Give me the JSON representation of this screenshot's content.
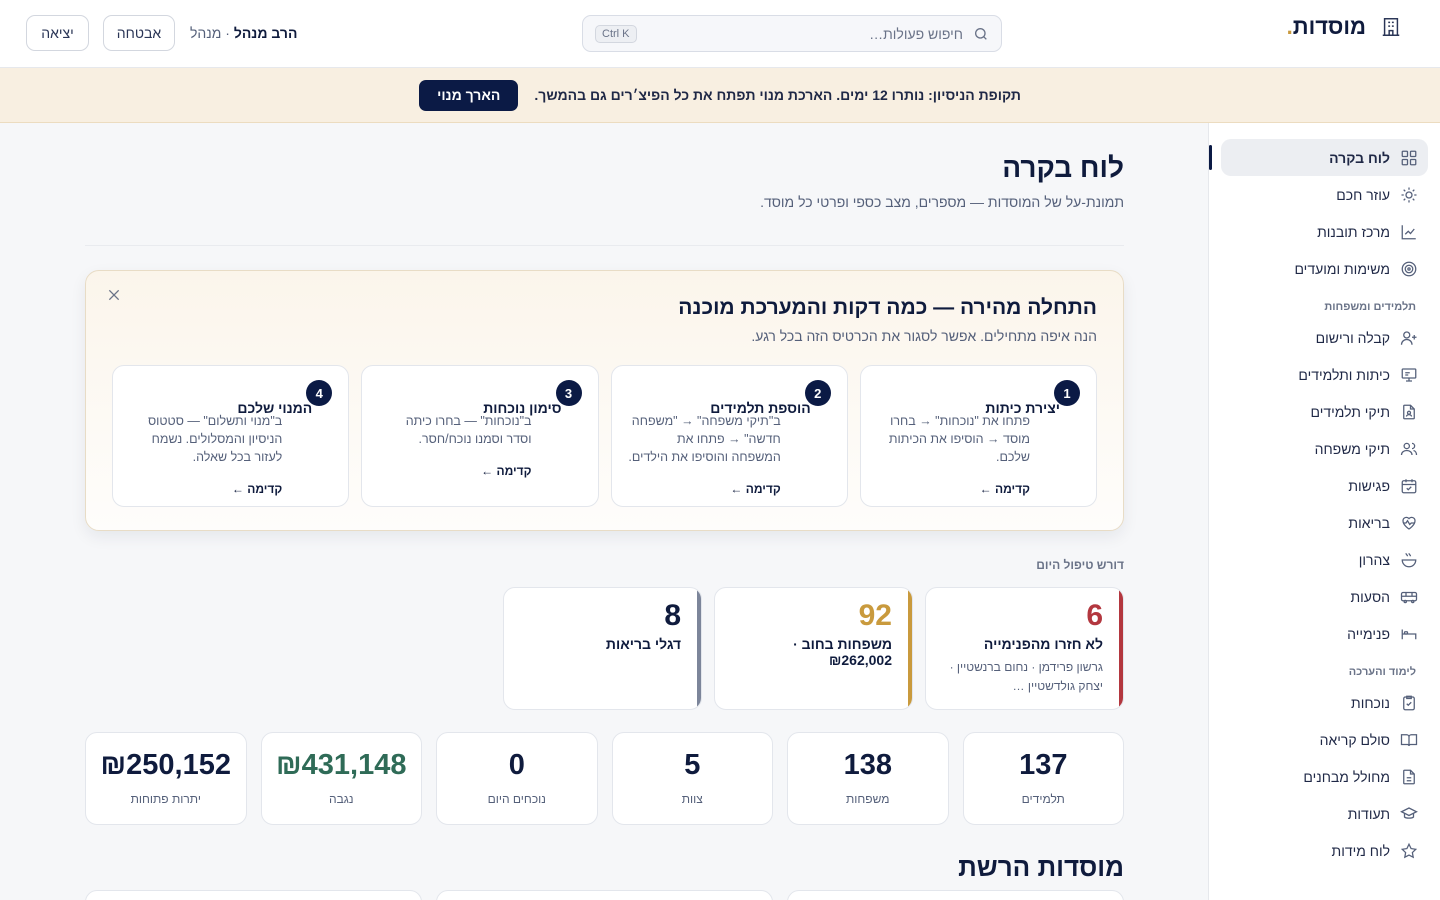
{
  "app": {
    "brand_name": "מוסדות",
    "brand_dot": "."
  },
  "header": {
    "search_placeholder": "חיפוש פעולות…",
    "search_shortcut": "Ctrl K",
    "user_name": "הרב מנהל",
    "user_role": " · מנהל",
    "security_label": "אבטחה",
    "logout_label": "יציאה"
  },
  "banner": {
    "text": "תקופת הניסיון: נותרו 12 ימים. הארכת מנוי תפתח את כל הפיצ׳רים גם בהמשך.",
    "button": "הארך מנוי"
  },
  "sidebar": {
    "top_items": [
      {
        "label": "לוח בקרה",
        "icon": "grid-icon",
        "active": true
      },
      {
        "label": "עוזר חכם",
        "icon": "sun-icon"
      },
      {
        "label": "מרכז תובנות",
        "icon": "chart-line-icon"
      },
      {
        "label": "משימות ומועדים",
        "icon": "target-icon"
      }
    ],
    "section_students": "תלמידים ומשפחות",
    "student_items": [
      {
        "label": "קבלה ורישום",
        "icon": "user-plus-icon"
      },
      {
        "label": "כיתות ותלמידים",
        "icon": "presentation-icon"
      },
      {
        "label": "תיקי תלמידים",
        "icon": "file-user-icon"
      },
      {
        "label": "תיקי משפחה",
        "icon": "users-icon"
      },
      {
        "label": "פגישות",
        "icon": "calendar-check-icon"
      },
      {
        "label": "בריאות",
        "icon": "heart-pulse-icon"
      },
      {
        "label": "צהרון",
        "icon": "bowl-icon"
      },
      {
        "label": "הסעות",
        "icon": "bus-icon"
      },
      {
        "label": "פנימייה",
        "icon": "bed-icon"
      }
    ],
    "section_learning": "לימוד והערכה",
    "learning_items": [
      {
        "label": "נוכחות",
        "icon": "clipboard-check-icon"
      },
      {
        "label": "סולם קריאה",
        "icon": "book-open-icon"
      },
      {
        "label": "מחולל מבחנים",
        "icon": "file-text-icon"
      },
      {
        "label": "תעודות",
        "icon": "graduation-cap-icon"
      },
      {
        "label": "לוח מידות",
        "icon": "star-icon"
      }
    ]
  },
  "main": {
    "title": "לוח בקרה",
    "subtitle": "תמונת-על של המוסדות — מספרים, מצב כספי ופרטי כל מוסד.",
    "onboarding": {
      "title": "התחלה מהירה — כמה דקות והמערכת מוכנה",
      "subtitle": "הנה איפה מתחילים. אפשר לסגור את הכרטיס הזה בכל רגע.",
      "steps": [
        {
          "num": "1",
          "title": "יצירת כיתות",
          "body": "פתחו את \"נוכחות\" → בחרו מוסד → הוסיפו את הכיתות שלכם.",
          "link": "קדימה ←"
        },
        {
          "num": "2",
          "title": "הוספת תלמידים",
          "body": "ב\"תיקי משפחה\" → \"משפחה חדשה\" → פתחו את המשפחה והוסיפו את הילדים.",
          "link": "קדימה ←"
        },
        {
          "num": "3",
          "title": "סימון נוכחות",
          "body": "ב\"נוכחות\" — בחרו כיתה וסדר וסמנו נוכח/חסר.",
          "link": "קדימה ←"
        },
        {
          "num": "4",
          "title": "המנוי שלכם",
          "body": "ב\"מנוי ותשלום\" — סטטוס הניסיון והמסלולים. נשמח לעזור בכל שאלה.",
          "link": "קדימה ←"
        }
      ]
    },
    "attention_label": "דורש טיפול היום",
    "alerts": [
      {
        "value": "6",
        "title": "לא חזרו מהפנימייה",
        "detail": "גרשון פרידמן · נחום ברנשטיין · יצחק גולדשטיין …",
        "tone": "red",
        "color": "#b3373f"
      },
      {
        "value": "92",
        "title": "משפחות בחוב · ₪262,002",
        "detail": "",
        "tone": "gold",
        "color": "#c99a3d"
      },
      {
        "value": "8",
        "title": "דגלי בריאות",
        "detail": "",
        "tone": "gray",
        "color": "#0f1b3d"
      }
    ],
    "stats": [
      {
        "value": "137",
        "label": "תלמידים"
      },
      {
        "value": "138",
        "label": "משפחות"
      },
      {
        "value": "5",
        "label": "צוות"
      },
      {
        "value": "0",
        "label": "נוכחים היום"
      },
      {
        "value": "₪431,148",
        "label": "נגבה",
        "tone": "green"
      },
      {
        "value": "₪250,152",
        "label": "יתרות פתוחות"
      }
    ],
    "network_title": "מוסדות הרשת"
  },
  "colors": {
    "navy": "#0b1a45",
    "gold": "#c99a3d",
    "red": "#b3373f",
    "green": "#2f6b57",
    "banner_bg": "#f8efe1"
  }
}
